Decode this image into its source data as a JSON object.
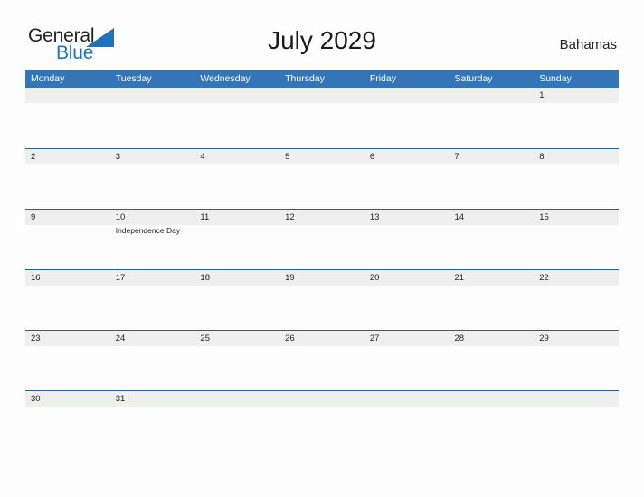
{
  "brand": {
    "name_part1": "General",
    "name_part2": "Blue",
    "triangle_color": "#1f73bb",
    "text_color": "#231f20"
  },
  "header": {
    "title": "July 2029",
    "country": "Bahamas"
  },
  "theme": {
    "header_blue": "#3575b5",
    "divider_blue": "#2a6099",
    "number_band_gray": "#efefef",
    "page_background": "#fdfdfd",
    "text_color": "#231f20"
  },
  "calendar": {
    "weekdays": [
      "Monday",
      "Tuesday",
      "Wednesday",
      "Thursday",
      "Friday",
      "Saturday",
      "Sunday"
    ],
    "weeks": [
      [
        {
          "day": ""
        },
        {
          "day": ""
        },
        {
          "day": ""
        },
        {
          "day": ""
        },
        {
          "day": ""
        },
        {
          "day": ""
        },
        {
          "day": "1"
        }
      ],
      [
        {
          "day": "2"
        },
        {
          "day": "3"
        },
        {
          "day": "4"
        },
        {
          "day": "5"
        },
        {
          "day": "6"
        },
        {
          "day": "7"
        },
        {
          "day": "8"
        }
      ],
      [
        {
          "day": "9"
        },
        {
          "day": "10",
          "event": "Independence Day"
        },
        {
          "day": "11"
        },
        {
          "day": "12"
        },
        {
          "day": "13"
        },
        {
          "day": "14"
        },
        {
          "day": "15"
        }
      ],
      [
        {
          "day": "16"
        },
        {
          "day": "17"
        },
        {
          "day": "18"
        },
        {
          "day": "19"
        },
        {
          "day": "20"
        },
        {
          "day": "21"
        },
        {
          "day": "22"
        }
      ],
      [
        {
          "day": "23"
        },
        {
          "day": "24"
        },
        {
          "day": "25"
        },
        {
          "day": "26"
        },
        {
          "day": "27"
        },
        {
          "day": "28"
        },
        {
          "day": "29"
        }
      ],
      [
        {
          "day": "30"
        },
        {
          "day": "31"
        },
        {
          "day": ""
        },
        {
          "day": ""
        },
        {
          "day": ""
        },
        {
          "day": ""
        },
        {
          "day": ""
        }
      ]
    ]
  }
}
